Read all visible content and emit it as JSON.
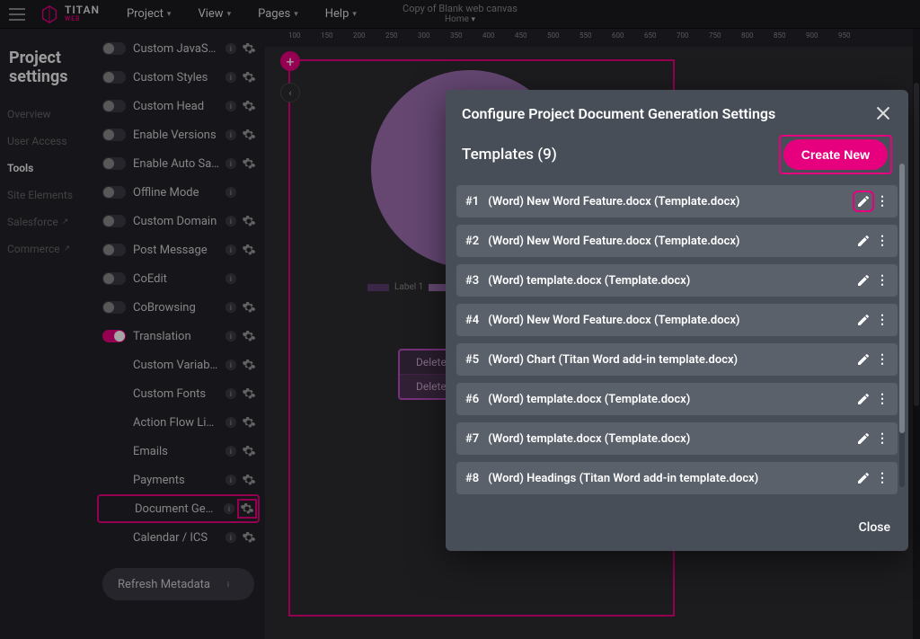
{
  "top": {
    "brand": "TITAN",
    "brand_sub": "WEB",
    "menu": [
      "Project",
      "View",
      "Pages",
      "Help"
    ],
    "doc_title": "Copy of Blank web canvas",
    "doc_sub": "Home"
  },
  "settings_title": "Project settings",
  "nav": [
    {
      "label": "Overview",
      "active": false,
      "ext": false
    },
    {
      "label": "User Access",
      "active": false,
      "ext": false
    },
    {
      "label": "Tools",
      "active": true,
      "ext": false
    },
    {
      "label": "Site Elements",
      "active": false,
      "ext": false
    },
    {
      "label": "Salesforce",
      "active": false,
      "ext": true
    },
    {
      "label": "Commerce",
      "active": false,
      "ext": true
    }
  ],
  "tools": [
    {
      "label": "Custom JavaScripts",
      "toggle": true,
      "on": false,
      "gear": true,
      "highlight": false
    },
    {
      "label": "Custom Styles",
      "toggle": true,
      "on": false,
      "gear": true,
      "highlight": false
    },
    {
      "label": "Custom Head",
      "toggle": true,
      "on": false,
      "gear": true,
      "highlight": false
    },
    {
      "label": "Enable Versions",
      "toggle": true,
      "on": false,
      "gear": true,
      "highlight": false
    },
    {
      "label": "Enable Auto Save",
      "toggle": true,
      "on": false,
      "gear": true,
      "highlight": false
    },
    {
      "label": "Offline Mode",
      "toggle": true,
      "on": false,
      "gear": false,
      "highlight": false
    },
    {
      "label": "Custom Domain",
      "toggle": true,
      "on": false,
      "gear": true,
      "highlight": false
    },
    {
      "label": "Post Message",
      "toggle": true,
      "on": false,
      "gear": true,
      "highlight": false
    },
    {
      "label": "CoEdit",
      "toggle": true,
      "on": false,
      "gear": false,
      "highlight": false
    },
    {
      "label": "CoBrowsing",
      "toggle": true,
      "on": false,
      "gear": true,
      "highlight": false
    },
    {
      "label": "Translation",
      "toggle": true,
      "on": true,
      "gear": true,
      "highlight": false
    },
    {
      "label": "Custom Variables",
      "toggle": false,
      "on": false,
      "gear": true,
      "highlight": false
    },
    {
      "label": "Custom Fonts",
      "toggle": false,
      "on": false,
      "gear": true,
      "highlight": false
    },
    {
      "label": "Action Flow Library",
      "toggle": false,
      "on": false,
      "gear": true,
      "highlight": false
    },
    {
      "label": "Emails",
      "toggle": false,
      "on": false,
      "gear": true,
      "highlight": false
    },
    {
      "label": "Payments",
      "toggle": false,
      "on": false,
      "gear": true,
      "highlight": false
    },
    {
      "label": "Document Generation",
      "toggle": false,
      "on": false,
      "gear": true,
      "highlight": true
    },
    {
      "label": "Calendar / ICS",
      "toggle": false,
      "on": false,
      "gear": true,
      "highlight": false
    }
  ],
  "refresh_label": "Refresh Metadata",
  "ruler_ticks": [
    100,
    150,
    200,
    250,
    300,
    350,
    400,
    450,
    500,
    550,
    600,
    650,
    700,
    750,
    800,
    850,
    900,
    950
  ],
  "canvas": {
    "legend_label": "Label 1",
    "deleted_rows": [
      "Deleted",
      "Deleted"
    ]
  },
  "modal": {
    "title": "Configure Project Document Generation Settings",
    "templates_label": "Templates (9)",
    "create_label": "Create New",
    "close_label": "Close",
    "rows": [
      {
        "idx": "#1",
        "text": "(Word)  New Word Feature.docx (Template.docx)",
        "hl": true
      },
      {
        "idx": "#2",
        "text": "(Word)  New Word Feature.docx (Template.docx)",
        "hl": false
      },
      {
        "idx": "#3",
        "text": "(Word)  template.docx (Template.docx)",
        "hl": false
      },
      {
        "idx": "#4",
        "text": "(Word)  New Word Feature.docx (Template.docx)",
        "hl": false
      },
      {
        "idx": "#5",
        "text": "(Word)  Chart (Titan Word add-in template.docx)",
        "hl": false
      },
      {
        "idx": "#6",
        "text": "(Word)  template.docx (Template.docx)",
        "hl": false
      },
      {
        "idx": "#7",
        "text": "(Word)  template.docx (Template.docx)",
        "hl": false
      },
      {
        "idx": "#8",
        "text": "(Word)  Headings (Titan Word add-in template.docx)",
        "hl": false
      }
    ]
  }
}
